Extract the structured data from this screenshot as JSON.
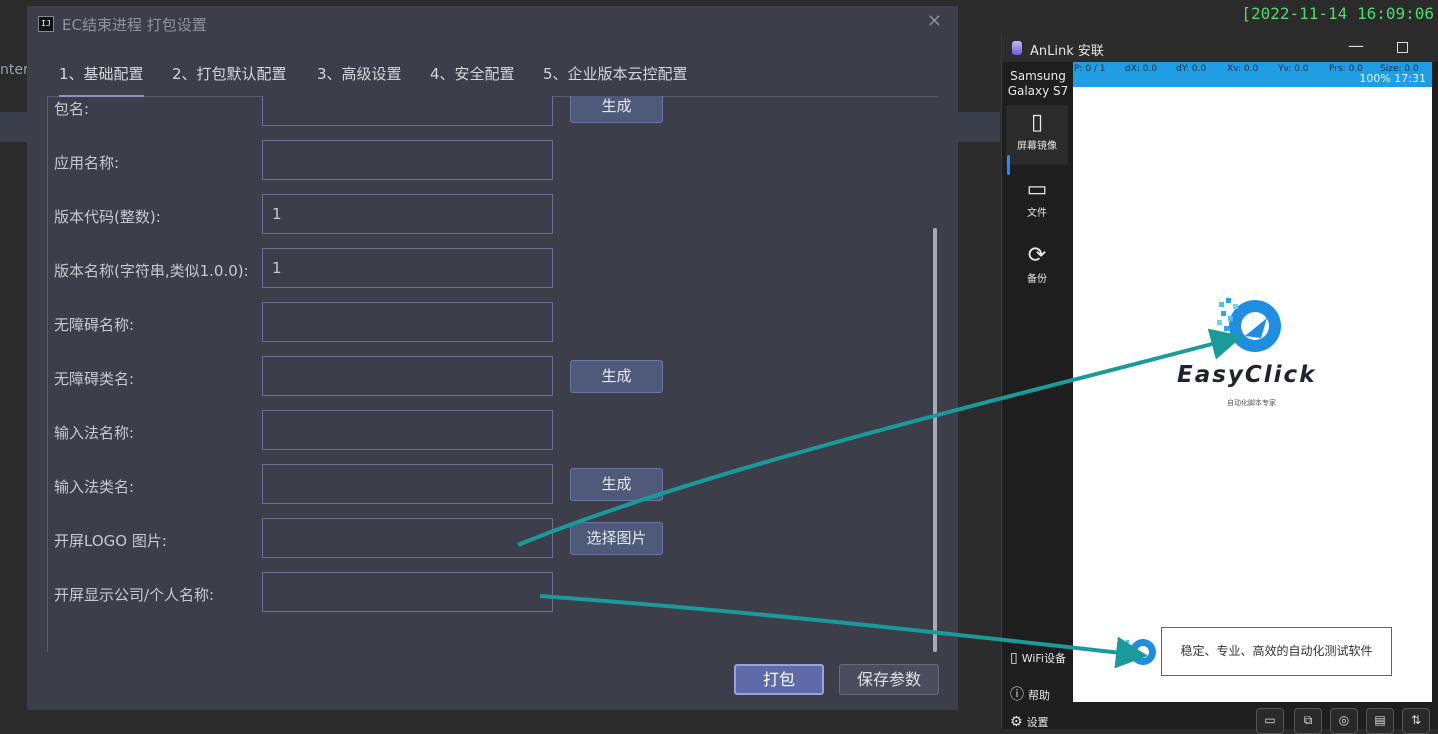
{
  "background": {
    "partial_text": "nter",
    "clock": "[2022-11-14 16:09:06"
  },
  "dialog": {
    "title": "EC结束进程 打包设置",
    "app_icon_text": "IJ",
    "close_icon": "×",
    "tabs": [
      {
        "label": "1、基础配置",
        "active": true
      },
      {
        "label": "2、打包默认配置",
        "active": false
      },
      {
        "label": "3、高级设置",
        "active": false
      },
      {
        "label": "4、安全配置",
        "active": false
      },
      {
        "label": "5、企业版本云控配置",
        "active": false
      }
    ],
    "form": {
      "package_name": {
        "label": "包名:",
        "value": "",
        "button": "生成"
      },
      "app_name": {
        "label": "应用名称:",
        "value": ""
      },
      "version_code": {
        "label": "版本代码(整数):",
        "value": "1"
      },
      "version_name": {
        "label": "版本名称(字符串,类似1.0.0):",
        "value": "1"
      },
      "accessibility_name": {
        "label": "无障碍名称:",
        "value": ""
      },
      "accessibility_class": {
        "label": "无障碍类名:",
        "value": "",
        "button": "生成"
      },
      "ime_name": {
        "label": "输入法名称:",
        "value": ""
      },
      "ime_class": {
        "label": "输入法类名:",
        "value": "",
        "button": "生成"
      },
      "splash_logo": {
        "label": "开屏LOGO 图片:",
        "value": "",
        "button": "选择图片"
      },
      "splash_company": {
        "label": "开屏显示公司/个人名称:",
        "value": ""
      }
    },
    "pack_button": "打包",
    "save_button": "保存参数"
  },
  "anlink": {
    "title": "AnLink 安联",
    "device_name": "Samsung Galaxy S7",
    "sidebar": [
      {
        "label": "屏幕镜像",
        "icon": "phone-icon",
        "active": true
      },
      {
        "label": "文件",
        "icon": "folder-icon",
        "active": false
      },
      {
        "label": "备份",
        "icon": "sync-icon",
        "active": false
      }
    ],
    "bottom_items": [
      {
        "label": "WiFi设备",
        "icon": "wifi-device-icon"
      },
      {
        "label": "帮助",
        "icon": "help-icon"
      },
      {
        "label": "设置",
        "icon": "gear-icon"
      }
    ],
    "phone": {
      "metrics": {
        "p": "P: 0 / 1",
        "dx": "dX: 0.0",
        "dy": "dY: 0.0",
        "xv": "Xv: 0.0",
        "yv": "Yv: 0.0",
        "prs": "Prs: 0.0",
        "size": "Size: 0.0"
      },
      "status_right": "100% 17:31",
      "brand": "EasyClick",
      "brand_sub": "自动化脚本专家",
      "slogan": "稳定、专业、高效的自动化测试软件"
    },
    "toolbar_icons": [
      "layout-icon",
      "devices-icon",
      "headset-icon",
      "keyboard-icon",
      "transfer-icon"
    ]
  },
  "colors": {
    "arrow": "#1a9a9a",
    "accent": "#1a8cff",
    "status_bar": "#1f9ee4"
  }
}
